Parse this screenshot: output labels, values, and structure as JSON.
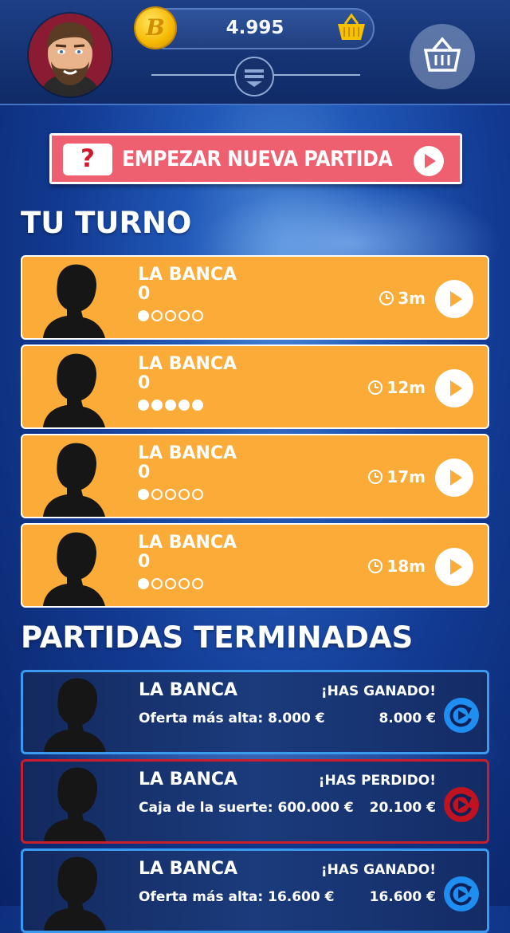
{
  "header": {
    "coin_symbol": "B",
    "coins": "4.995",
    "avatar_icon": "player-avatar",
    "menu_icon": "menu-icon",
    "shop_icon": "shopping-basket-icon"
  },
  "new_game": {
    "icon_text": "?",
    "label": "EMPEZAR NUEVA PARTIDA"
  },
  "sections": {
    "your_turn": "TU TURNO",
    "finished": "PARTIDAS TERMINADAS"
  },
  "turns": [
    {
      "name": "LA BANCA",
      "score": "0",
      "progress_filled": 1,
      "progress_total": 5,
      "time": "3m"
    },
    {
      "name": "LA BANCA",
      "score": "0",
      "progress_filled": 5,
      "progress_total": 5,
      "time": "12m"
    },
    {
      "name": "LA BANCA",
      "score": "0",
      "progress_filled": 1,
      "progress_total": 5,
      "time": "17m"
    },
    {
      "name": "LA BANCA",
      "score": "0",
      "progress_filled": 1,
      "progress_total": 5,
      "time": "18m"
    }
  ],
  "finished": [
    {
      "name": "LA BANCA",
      "result": "¡HAS GANADO!",
      "detail": "Oferta más alta: 8.000 €",
      "amount": "8.000 €",
      "status": "won"
    },
    {
      "name": "LA BANCA",
      "result": "¡HAS PERDIDO!",
      "detail": "Caja de la suerte: 600.000 €",
      "amount": "20.100 €",
      "status": "lost"
    },
    {
      "name": "LA BANCA",
      "result": "¡HAS GANADO!",
      "detail": "Oferta más alta: 16.600 €",
      "amount": "16.600 €",
      "status": "won"
    }
  ],
  "colors": {
    "turn_card": "#fbab37",
    "new_game": "#ee5f70",
    "won_border": "#3b9af0",
    "lost_border": "#c7202c",
    "won_icon": "#1e8ef0",
    "lost_icon": "#c0131f"
  }
}
